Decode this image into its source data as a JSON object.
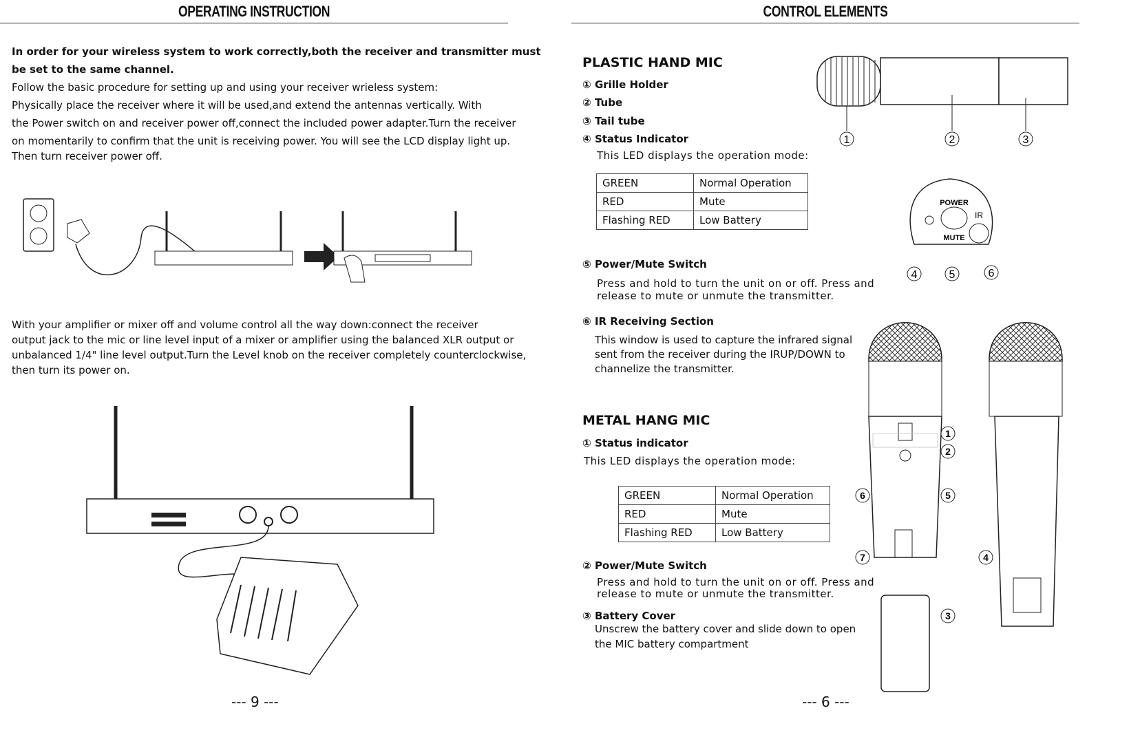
{
  "left_page": {
    "header": "OPERATING INSTRUCTION",
    "intro_bold": [
      "In order for your wireless system to work correctly,both the receiver and transmitter must",
      "be set to the same channel."
    ],
    "intro": [
      "Follow the basic procedure for setting up and using your receiver wrieless system:",
      "Physically place the  receiver where it will be used,and extend the antennas vertically. With",
      "the Power switch on and  receiver power off,connect the included power adapter.Turn the  receiver",
      "on momentarily to confirm that the unit is receiving power. You will see the LCD display light up.",
      "Then turn  receiver power off."
    ],
    "step2": [
      "With your amplifier or mixer off and volume control all the way down:connect the  receiver",
      "output jack to the mic or line level input of a mixer or amplifier using the balanced XLR output or",
      "unbalanced 1/4\" line level output.Turn the Level knob on the  receiver completely counterclockwise,",
      "then turn its power on."
    ],
    "page_number": "--- 9 ---"
  },
  "right_page": {
    "header": "CONTROL ELEMENTS",
    "plastic": {
      "title": "PLASTIC HAND MIC",
      "items": [
        {
          "num": "①",
          "label": "Grille Holder"
        },
        {
          "num": "②",
          "label": "Tube"
        },
        {
          "num": "③",
          "label": "Tail tube"
        },
        {
          "num": "④",
          "label": "Status Indicator"
        }
      ],
      "status_desc": "This LED displays the operation mode:",
      "led_table": [
        [
          "GREEN",
          "Normal Operation"
        ],
        [
          "RED",
          "Mute"
        ],
        [
          "Flashing RED",
          "Low Battery"
        ]
      ],
      "item5": {
        "num": "⑤",
        "label": "Power/Mute Switch",
        "desc": [
          "Press and hold to turn the unit on or off. Press and",
          "release to mute or unmute the transmitter."
        ]
      },
      "item6": {
        "num": "⑥",
        "label": "IR Receiving Section",
        "desc": [
          "This window is used to capture the infrared signal",
          "sent from the receiver during the IRUP/DOWN to",
          "channelize the transmitter."
        ]
      },
      "callouts": [
        "1",
        "2",
        "3"
      ],
      "panel": {
        "power": "POWER",
        "mute": "MUTE",
        "ir": "IR",
        "callouts": [
          "4",
          "5",
          "6"
        ]
      }
    },
    "metal": {
      "title": "METAL HANG MIC",
      "item1": {
        "num": "①",
        "label": "Status indicator"
      },
      "status_desc": "This LED displays the operation mode:",
      "led_table": [
        [
          "GREEN",
          "Normal Operation"
        ],
        [
          "RED",
          "Mute"
        ],
        [
          "Flashing RED",
          "Low Battery"
        ]
      ],
      "item2": {
        "num": "②",
        "label": "Power/Mute Switch",
        "desc": [
          "Press and hold to turn the unit on or off. Press and",
          "release to mute or unmute the transmitter."
        ]
      },
      "item3": {
        "num": "③",
        "label": "Battery Cover",
        "desc": [
          "Unscrew the battery cover and slide down to open",
          "the  MIC  battery compartment"
        ]
      },
      "callouts": [
        "1",
        "2",
        "3",
        "4",
        "5",
        "6",
        "7"
      ]
    },
    "page_number": "--- 6 ---"
  }
}
